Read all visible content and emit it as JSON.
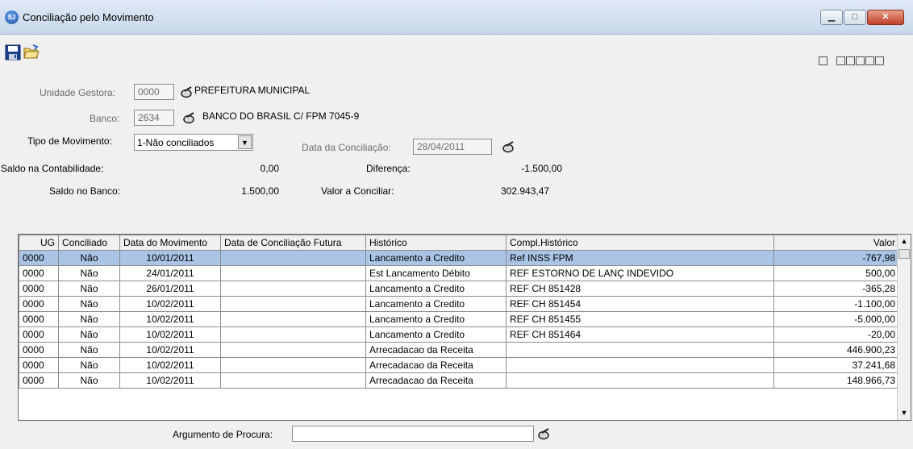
{
  "window": {
    "title": "Conciliação pelo Movimento",
    "app_icon_text": "SJ",
    "minimize": "▁",
    "maximize": "□",
    "close": "✕"
  },
  "toolbar": {
    "save_icon": "save-disk-icon",
    "open_icon": "folder-open-icon"
  },
  "form": {
    "unidade_gestora": {
      "label": "Unidade Gestora:",
      "code": "0000",
      "name": "PREFEITURA MUNICIPAL"
    },
    "banco": {
      "label": "Banco:",
      "code": "2634",
      "name": "BANCO DO BRASIL C/ FPM  7045-9"
    },
    "tipo_movimento": {
      "label": "Tipo de Movimento:",
      "selected": "1-Não conciliados"
    },
    "data_conciliacao": {
      "label": "Data da Conciliação:",
      "value": "28/04/2011"
    },
    "saldo_contabilidade": {
      "label": "Saldo na Contabilidade:",
      "value": "0,00"
    },
    "saldo_banco": {
      "label": "Saldo no Banco:",
      "value": "1.500,00"
    },
    "diferenca": {
      "label": "Diferença:",
      "value": "-1.500,00"
    },
    "valor_conciliar": {
      "label": "Valor a Conciliar:",
      "value": "302.943,47"
    }
  },
  "grid": {
    "columns": [
      "UG",
      "Conciliado",
      "Data do Movimento",
      "Data de Conciliação Futura",
      "Histórico",
      "Compl.Histórico",
      "Valor"
    ],
    "rows": [
      [
        "0000",
        "Não",
        "10/01/2011",
        "",
        "Lancamento a Credito",
        "Ref INSS FPM",
        "-767,98"
      ],
      [
        "0000",
        "Não",
        "24/01/2011",
        "",
        "Est Lancamento Débito",
        "REF ESTORNO DE LANÇ INDEVIDO",
        "500,00"
      ],
      [
        "0000",
        "Não",
        "26/01/2011",
        "",
        "Lancamento a Credito",
        "REF CH 851428",
        "-365,28"
      ],
      [
        "0000",
        "Não",
        "10/02/2011",
        "",
        "Lancamento a Credito",
        "REF CH 851454",
        "-1.100,00"
      ],
      [
        "0000",
        "Não",
        "10/02/2011",
        "",
        "Lancamento a Credito",
        "REF CH 851455",
        "-5.000,00"
      ],
      [
        "0000",
        "Não",
        "10/02/2011",
        "",
        "Lancamento a Credito",
        "REF CH 851464",
        "-20,00"
      ],
      [
        "0000",
        "Não",
        "10/02/2011",
        "",
        "Arrecadacao da Receita",
        "",
        "446.900,23"
      ],
      [
        "0000",
        "Não",
        "10/02/2011",
        "",
        "Arrecadacao da Receita",
        "",
        "37.241,68"
      ],
      [
        "0000",
        "Não",
        "10/02/2011",
        "",
        "Arrecadacao da Receita",
        "",
        "148.966,73"
      ]
    ]
  },
  "search": {
    "label": "Argumento de Procura:",
    "value": ""
  }
}
